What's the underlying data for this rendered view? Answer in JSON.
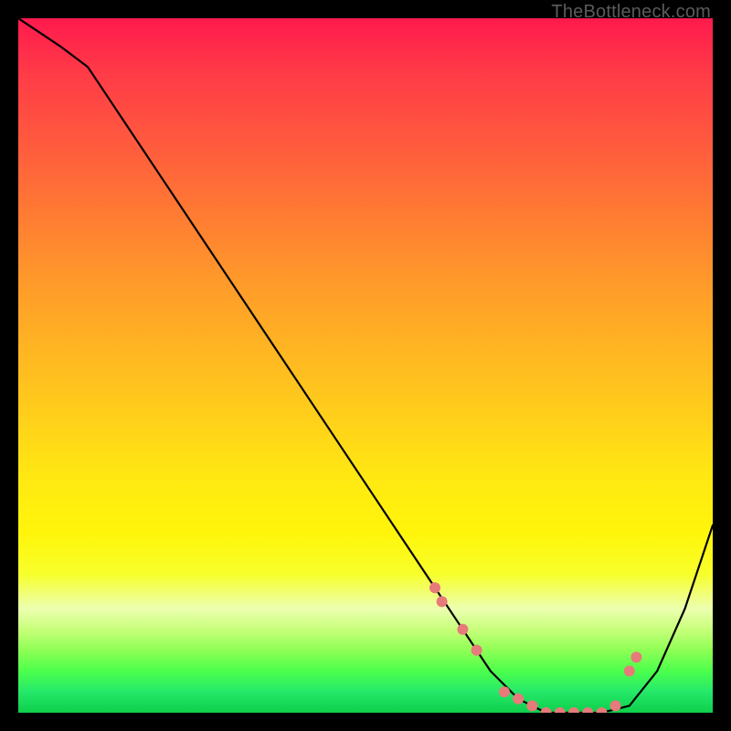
{
  "attribution": "TheBottleneck.com",
  "chart_data": {
    "type": "line",
    "title": "",
    "xlabel": "",
    "ylabel": "",
    "xlim": [
      0,
      100
    ],
    "ylim": [
      0,
      100
    ],
    "series": [
      {
        "name": "curve",
        "x": [
          0,
          3,
          6,
          10,
          20,
          30,
          40,
          50,
          56,
          60,
          64,
          68,
          72,
          76,
          80,
          84,
          88,
          92,
          96,
          100
        ],
        "y": [
          100,
          98,
          96,
          93,
          78,
          63,
          48,
          33,
          24,
          18,
          12,
          6,
          2,
          0,
          0,
          0,
          1,
          6,
          15,
          27
        ]
      }
    ],
    "markers": {
      "name": "highlight-dots",
      "color": "#e77a7a",
      "x": [
        60,
        61,
        64,
        66,
        70,
        72,
        74,
        76,
        78,
        80,
        82,
        84,
        86,
        88,
        89
      ],
      "y": [
        18,
        16,
        12,
        9,
        3,
        2,
        1,
        0,
        0,
        0,
        0,
        0,
        1,
        6,
        8
      ]
    }
  }
}
